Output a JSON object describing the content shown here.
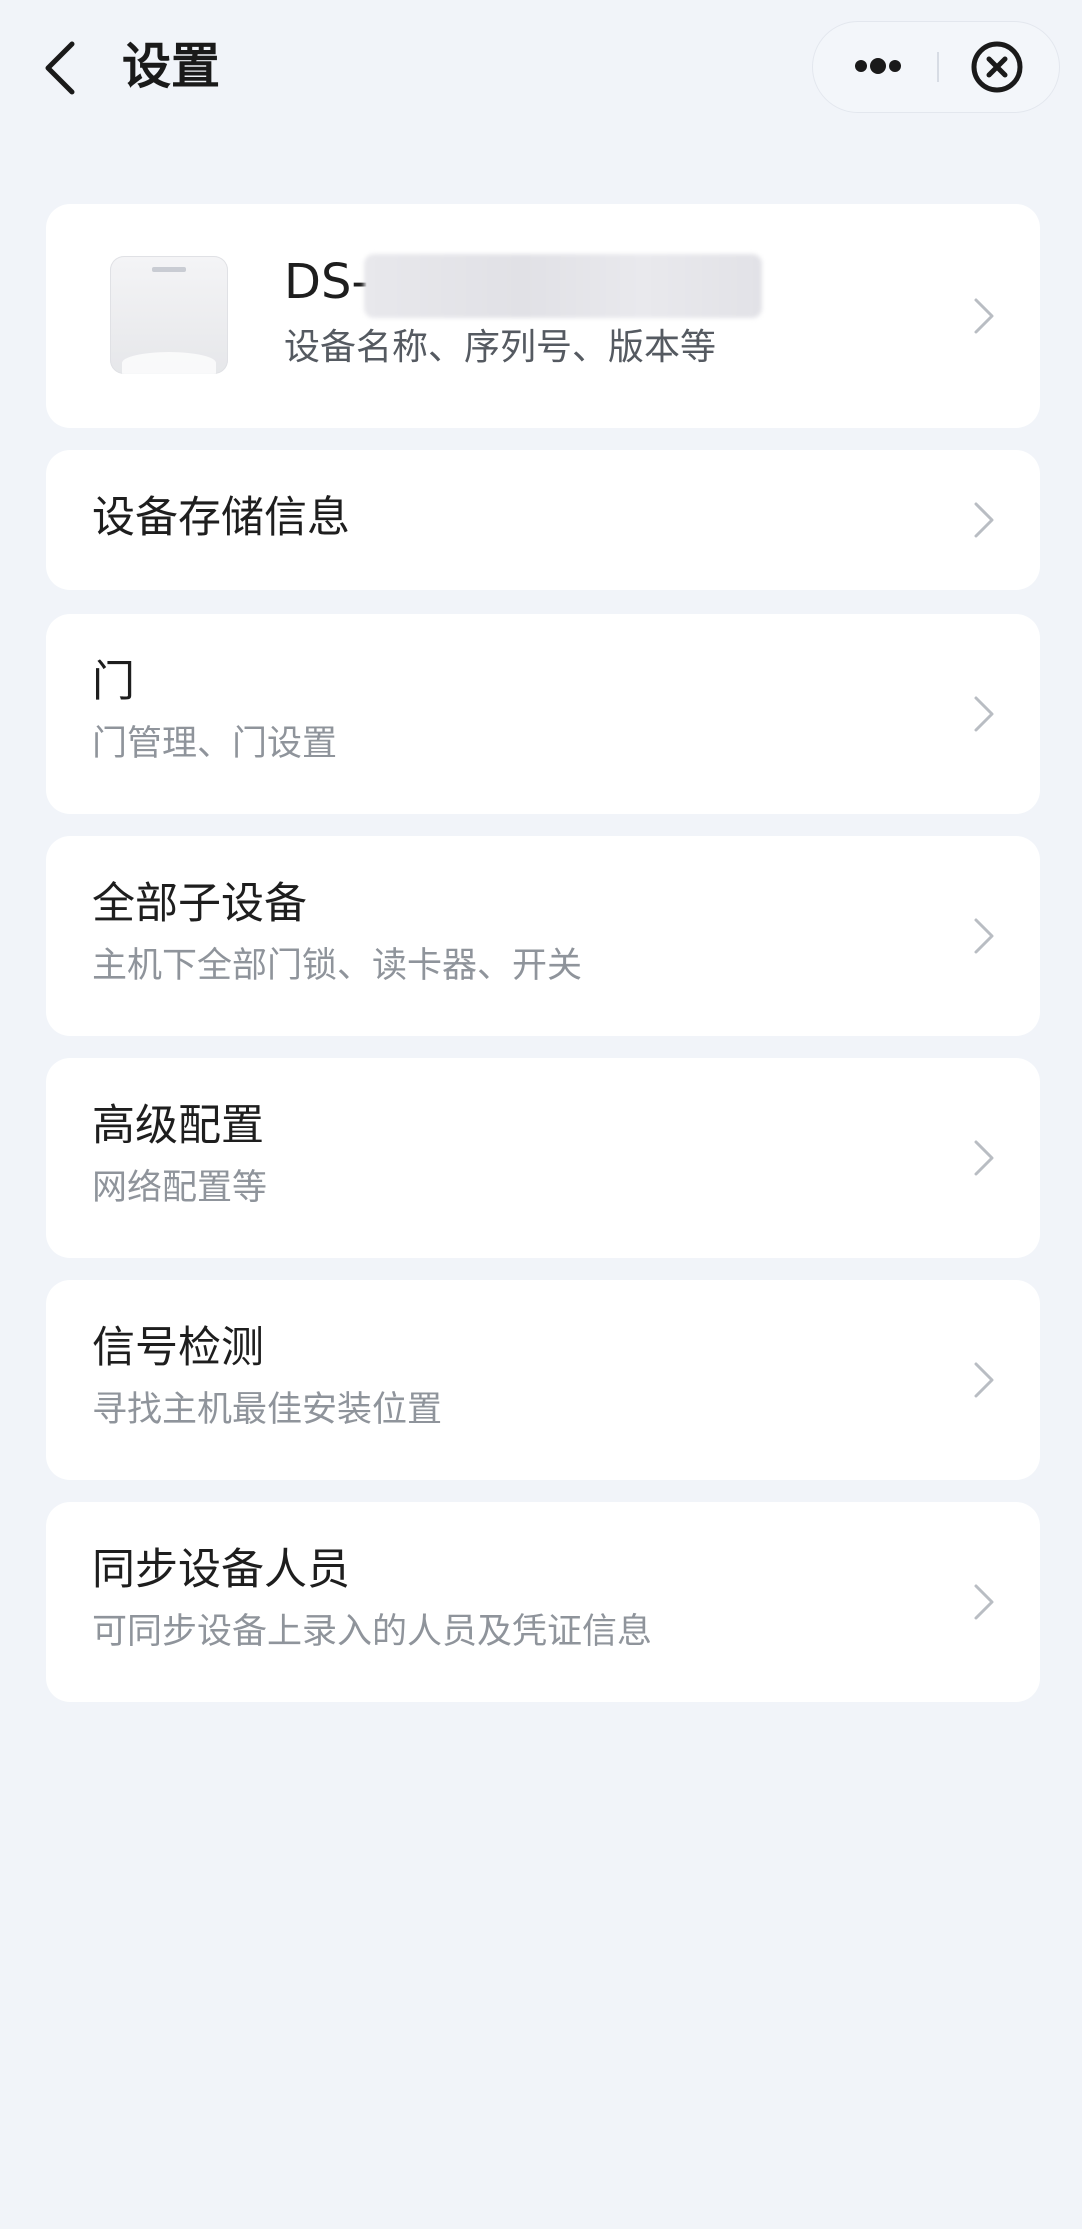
{
  "header": {
    "title": "设置",
    "back_icon": "chevron-left-icon",
    "more_icon": "more-dots-icon",
    "close_icon": "close-circle-icon"
  },
  "device_card": {
    "name_prefix": "DS-",
    "name_redacted": true,
    "subtitle": "设备名称、序列号、版本等",
    "image": "device-thumbnail"
  },
  "menu_items": [
    {
      "title": "设备存储信息",
      "subtitle": ""
    },
    {
      "title": "门",
      "subtitle": "门管理、门设置"
    },
    {
      "title": "全部子设备",
      "subtitle": "主机下全部门锁、读卡器、开关"
    },
    {
      "title": "高级配置",
      "subtitle": "网络配置等"
    },
    {
      "title": "信号检测",
      "subtitle": "寻找主机最佳安装位置"
    },
    {
      "title": "同步设备人员",
      "subtitle": "可同步设备上录入的人员及凭证信息"
    }
  ],
  "colors": {
    "background": "#f1f4f9",
    "card": "#ffffff",
    "title_text": "#1e1e1e",
    "subtitle_text": "#8f949b",
    "chevron": "#b9bdc3"
  }
}
